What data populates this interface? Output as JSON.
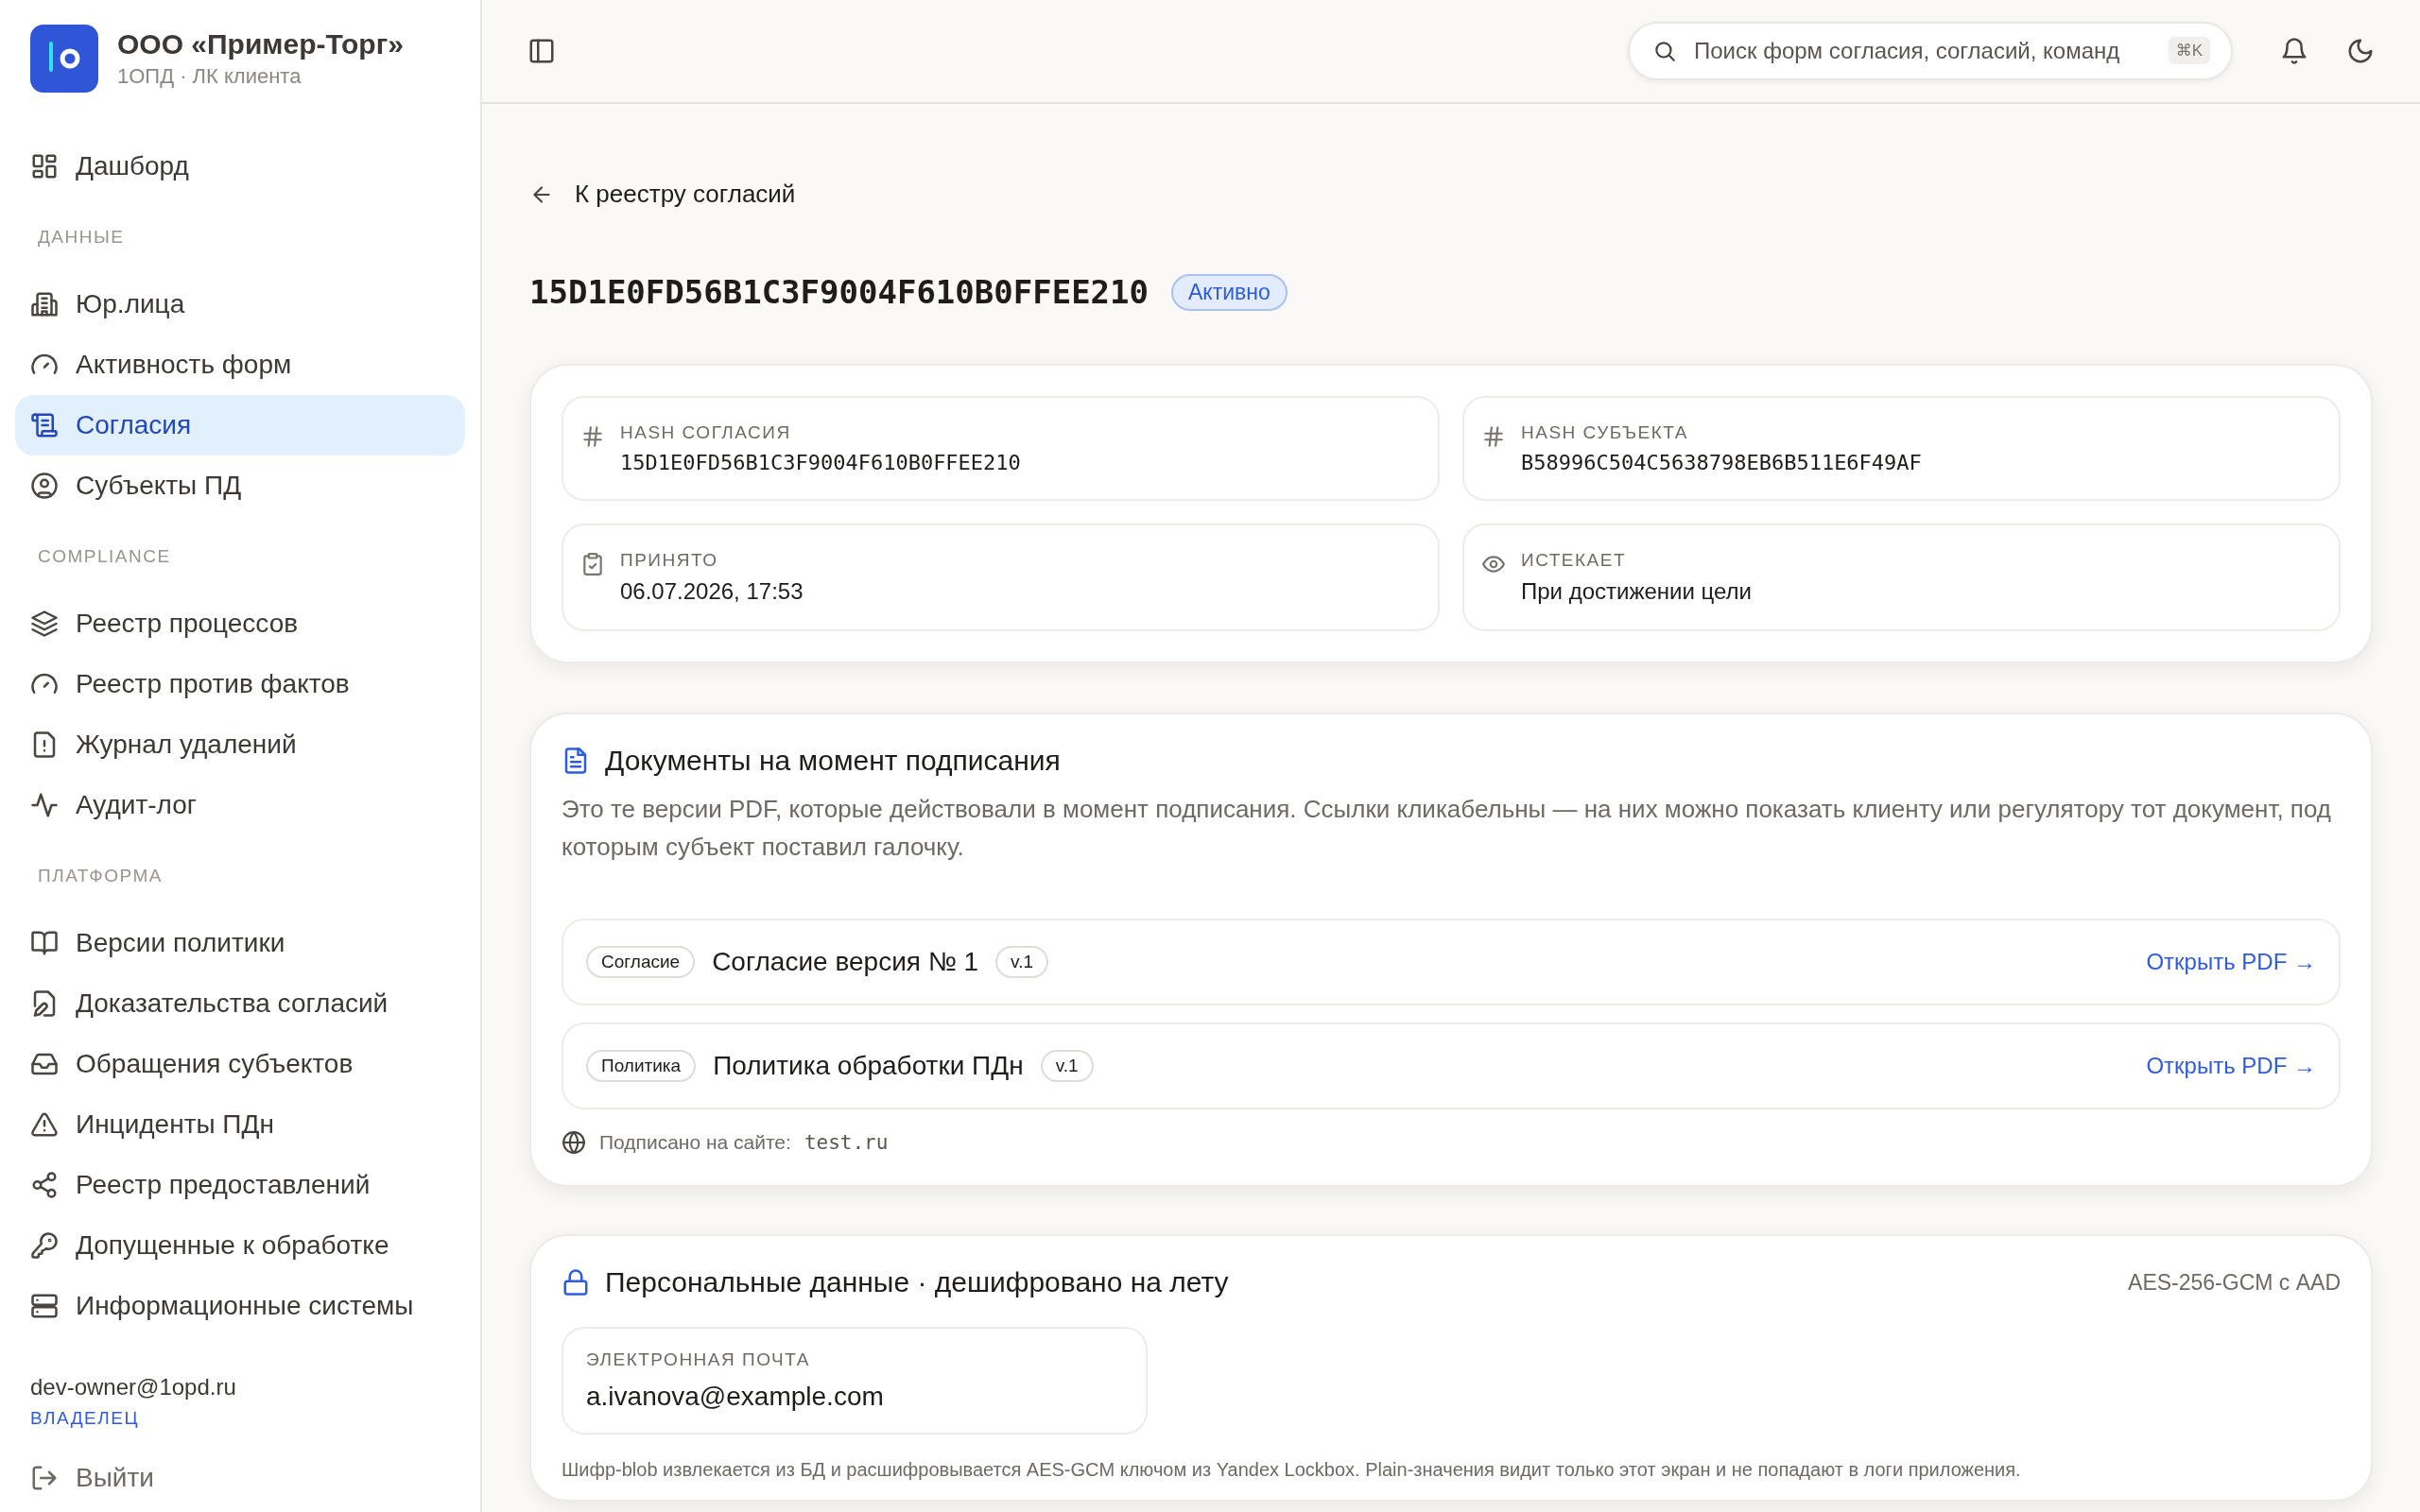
{
  "sidebar": {
    "org": {
      "name": "ООО «Пример-Торг»",
      "subtitle": "1ОПД · ЛК клиента"
    },
    "groups": [
      {
        "items": [
          {
            "label": "Дашборд",
            "selected": false
          }
        ]
      },
      {
        "heading": "ДАННЫЕ",
        "items": [
          {
            "label": "Юр.лица",
            "selected": false
          },
          {
            "label": "Активность форм",
            "selected": false
          },
          {
            "label": "Согласия",
            "selected": true
          },
          {
            "label": "Субъекты ПД",
            "selected": false
          }
        ]
      },
      {
        "heading": "COMPLIANCE",
        "items": [
          {
            "label": "Реестр процессов",
            "selected": false
          },
          {
            "label": "Реестр против фактов",
            "selected": false
          },
          {
            "label": "Журнал удалений",
            "selected": false
          },
          {
            "label": "Аудит-лог",
            "selected": false
          }
        ]
      },
      {
        "heading": "ПЛАТФОРМА",
        "items": [
          {
            "label": "Версии политики",
            "selected": false
          },
          {
            "label": "Доказательства согласий",
            "selected": false
          },
          {
            "label": "Обращения субъектов",
            "selected": false
          },
          {
            "label": "Инциденты ПДн",
            "selected": false
          },
          {
            "label": "Реестр предоставлений",
            "selected": false
          },
          {
            "label": "Допущенные к обработке",
            "selected": false
          },
          {
            "label": "Информационные системы",
            "selected": false
          }
        ]
      }
    ],
    "user": {
      "email": "dev-owner@1opd.ru",
      "role": "ВЛАДЕЛЕЦ"
    },
    "logout": "Выйти"
  },
  "topbar": {
    "search": {
      "placeholder": "Поиск форм согласия, согласий, команд",
      "shortcut": "⌘K"
    }
  },
  "back_link": "К реестру согласий",
  "consent": {
    "id": "15D1E0FD56B1C3F9004F610B0FFEE210",
    "status": "Активно"
  },
  "details": [
    {
      "kind": "hash",
      "label": "HASH СОГЛАСИЯ",
      "value": "15D1E0FD56B1C3F9004F610B0FFEE210"
    },
    {
      "kind": "hash",
      "label": "HASH СУБЪЕКТА",
      "value": "B58996C504C5638798EB6B511E6F49AF"
    },
    {
      "kind": "text",
      "label": "ПРИНЯТО",
      "value": "06.07.2026, 17:53"
    },
    {
      "kind": "text",
      "label": "ИСТЕКАЕТ",
      "value": "При достижении цели"
    }
  ],
  "documents": {
    "title": "Документы на момент подписания",
    "description": "Это те версии PDF, которые действовали в момент подписания. Ссылки кликабельны — на них можно показать клиенту или регулятору тот документ, под которым субъект поставил галочку.",
    "rows": [
      {
        "tag": "Согласие",
        "title": "Согласие версия № 1",
        "version": "v.1",
        "link": "Открыть PDF →"
      },
      {
        "tag": "Политика",
        "title": "Политика обработки ПДн",
        "version": "v.1",
        "link": "Открыть PDF →"
      }
    ],
    "site_label": "Подписано на сайте:",
    "site": "test.ru"
  },
  "personal": {
    "title": "Персональные данные · дешифровано на лету",
    "cipher": "AES-256-GCM с AAD",
    "fields": [
      {
        "label": "ЭЛЕКТРОННАЯ ПОЧТА",
        "value": "a.ivanova@example.com"
      }
    ],
    "note": "Шифр-blob извлекается из БД и расшифровывается AES-GCM ключом из Yandex Lockbox. Plain-значения видит только этот экран и не попадают в логи приложения."
  }
}
